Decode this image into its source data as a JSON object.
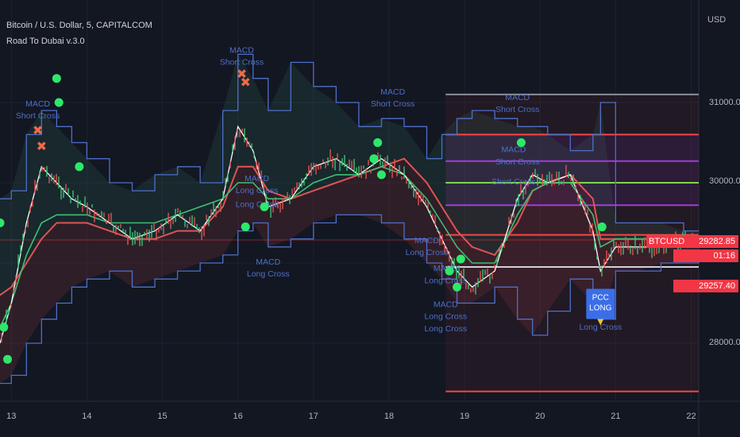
{
  "header": {
    "symbol_line": "Bitcoin / U.S. Dollar, 5, CAPITALCOM",
    "indicator": "Road To Dubai v.3.0"
  },
  "price_axis": {
    "currency": "USD",
    "ticks": [
      "31000.00",
      "30000.00",
      "28000.00"
    ]
  },
  "price_tags": {
    "symbol": "BTCUSD",
    "last": "29282.85",
    "countdown": "01:16",
    "low": "29257.40"
  },
  "colors": {
    "background": "#131722",
    "band": "#4f6fc7",
    "ema_fast": "#ffffff",
    "ema_mid": "#3fbf73",
    "ema_slow": "#e05353",
    "signal_dot": "#2ee86a",
    "short_marker": "#ef6a4a",
    "accent_red": "#f23645",
    "level_red": "#f44747",
    "level_purple": "#a13dd6",
    "level_green": "#7fd64a"
  },
  "chart_data": {
    "type": "line",
    "title": "Bitcoin / U.S. Dollar, 5, CAPITALCOM",
    "x_ticks": [
      "13",
      "14",
      "15",
      "16",
      "17",
      "18",
      "19",
      "20",
      "21",
      "22"
    ],
    "x_range_days": [
      12.85,
      22.1
    ],
    "ylim": [
      27300,
      31900
    ],
    "grid": true,
    "series": [
      {
        "name": "upper band",
        "color": "#4f6fc7",
        "x": [
          12.85,
          13.0,
          13.2,
          13.4,
          13.6,
          13.8,
          14.0,
          14.3,
          14.6,
          14.9,
          15.2,
          15.5,
          15.8,
          16.0,
          16.2,
          16.4,
          16.7,
          17.0,
          17.3,
          17.6,
          17.9,
          18.2,
          18.5,
          18.7,
          18.9,
          19.1,
          19.4,
          19.7,
          19.9,
          20.1,
          20.4,
          20.7,
          20.8,
          21.0,
          21.3,
          21.6,
          21.9,
          22.1
        ],
        "values": [
          29800,
          29900,
          30600,
          30900,
          30700,
          30500,
          30300,
          30000,
          29900,
          30100,
          30200,
          30000,
          30900,
          31600,
          31300,
          30900,
          31500,
          31200,
          31000,
          30700,
          30800,
          30700,
          30300,
          30600,
          30800,
          30900,
          30800,
          30700,
          30700,
          30600,
          30400,
          30600,
          31000,
          29500,
          29500,
          29500,
          29400,
          29400
        ]
      },
      {
        "name": "lower band",
        "color": "#4f6fc7",
        "x": [
          12.85,
          13.0,
          13.2,
          13.4,
          13.6,
          13.8,
          14.0,
          14.3,
          14.6,
          14.9,
          15.2,
          15.5,
          15.8,
          16.0,
          16.2,
          16.4,
          16.7,
          17.0,
          17.3,
          17.6,
          17.9,
          18.2,
          18.5,
          18.7,
          18.9,
          19.1,
          19.4,
          19.7,
          19.9,
          20.1,
          20.4,
          20.7,
          20.8,
          21.0,
          21.3,
          21.6,
          21.9,
          22.1
        ],
        "values": [
          27500,
          27600,
          28000,
          28300,
          28500,
          28700,
          28800,
          28900,
          28700,
          28800,
          28900,
          29000,
          29100,
          29400,
          29500,
          29200,
          29300,
          29500,
          29600,
          29600,
          29500,
          29300,
          29000,
          28800,
          28500,
          28500,
          28700,
          28300,
          28100,
          28400,
          28800,
          28500,
          28300,
          28900,
          28900,
          29000,
          29000,
          29100
        ]
      },
      {
        "name": "EMA fast",
        "color": "#ffffff",
        "x": [
          12.85,
          13.0,
          13.2,
          13.4,
          13.6,
          13.8,
          14.0,
          14.3,
          14.6,
          14.9,
          15.2,
          15.5,
          15.8,
          16.0,
          16.2,
          16.4,
          16.7,
          17.0,
          17.3,
          17.6,
          17.9,
          18.2,
          18.5,
          18.7,
          18.9,
          19.1,
          19.4,
          19.7,
          19.9,
          20.1,
          20.4,
          20.7,
          20.8,
          21.0,
          21.3,
          21.6,
          21.9,
          22.1
        ],
        "values": [
          28000,
          28500,
          29500,
          30200,
          30000,
          29800,
          29700,
          29500,
          29300,
          29400,
          29600,
          29400,
          29800,
          30700,
          30400,
          29700,
          29800,
          30200,
          30300,
          30100,
          30300,
          30100,
          29700,
          29300,
          28900,
          28700,
          28900,
          29800,
          30100,
          30000,
          30100,
          29400,
          28900,
          29200,
          29200,
          29200,
          29300,
          29300
        ]
      },
      {
        "name": "EMA mid",
        "color": "#3fbf73",
        "x": [
          12.85,
          13.0,
          13.2,
          13.4,
          13.6,
          13.8,
          14.0,
          14.3,
          14.6,
          14.9,
          15.2,
          15.5,
          15.8,
          16.0,
          16.2,
          16.4,
          16.7,
          17.0,
          17.3,
          17.6,
          17.9,
          18.2,
          18.5,
          18.7,
          18.9,
          19.1,
          19.4,
          19.7,
          19.9,
          20.1,
          20.4,
          20.7,
          20.8,
          21.0,
          21.3,
          21.6,
          21.9,
          22.1
        ],
        "values": [
          28200,
          28500,
          29100,
          29500,
          29600,
          29600,
          29600,
          29500,
          29500,
          29500,
          29600,
          29700,
          29800,
          30000,
          30000,
          29800,
          29800,
          30000,
          30100,
          30100,
          30200,
          30100,
          29800,
          29500,
          29200,
          29000,
          29000,
          29600,
          29900,
          30000,
          30000,
          29600,
          29200,
          29300,
          29300,
          29300,
          29300,
          29300
        ]
      },
      {
        "name": "EMA slow",
        "color": "#e05353",
        "x": [
          12.85,
          13.0,
          13.2,
          13.4,
          13.6,
          13.8,
          14.0,
          14.3,
          14.6,
          14.9,
          15.2,
          15.5,
          15.8,
          16.0,
          16.2,
          16.4,
          16.7,
          17.0,
          17.3,
          17.6,
          17.9,
          18.2,
          18.5,
          18.7,
          18.9,
          19.1,
          19.4,
          19.7,
          19.9,
          20.1,
          20.4,
          20.7,
          20.8,
          21.0,
          21.3,
          21.6,
          21.9,
          22.1
        ],
        "values": [
          28600,
          28700,
          29000,
          29300,
          29500,
          29500,
          29500,
          29400,
          29300,
          29300,
          29400,
          29400,
          29700,
          30200,
          30200,
          29900,
          29800,
          29900,
          30000,
          30100,
          30200,
          30300,
          30000,
          29700,
          29400,
          29200,
          29100,
          29500,
          29900,
          30000,
          30100,
          29800,
          29300,
          29300,
          29300,
          29300,
          29300,
          29300
        ]
      }
    ],
    "levels": [
      {
        "y": 31100,
        "color": "#8a8f9a",
        "x_start": 18.75
      },
      {
        "y": 30600,
        "color": "#f44747",
        "x_start": 18.75
      },
      {
        "y": 30270,
        "color": "#a13dd6",
        "x_start": 18.75
      },
      {
        "y": 30000,
        "color": "#7fd64a",
        "x_start": 18.75
      },
      {
        "y": 29720,
        "color": "#a13dd6",
        "x_start": 18.75
      },
      {
        "y": 29350,
        "color": "#f44747",
        "x_start": 18.75
      },
      {
        "y": 28950,
        "color": "#cfd2d8",
        "x_start": 18.75
      },
      {
        "y": 27400,
        "color": "#f44747",
        "x_start": 18.75
      }
    ],
    "annotations": [
      {
        "text": "MACD",
        "x": 13.35,
        "y": 30950,
        "color": "#4f6fc7"
      },
      {
        "text": "Short Cross",
        "x": 13.35,
        "y": 30800,
        "color": "#4f6fc7"
      },
      {
        "text": "MACD",
        "x": 16.05,
        "y": 31620,
        "color": "#4f6fc7"
      },
      {
        "text": "Short Cross",
        "x": 16.05,
        "y": 31470,
        "color": "#4f6fc7"
      },
      {
        "text": "MACD",
        "x": 16.25,
        "y": 30020,
        "color": "#4f6fc7"
      },
      {
        "text": "Long Cross",
        "x": 16.25,
        "y": 29870,
        "color": "#4f6fc7"
      },
      {
        "text": "Long Cross",
        "x": 16.25,
        "y": 29700,
        "color": "#4f6fc7"
      },
      {
        "text": "MACD",
        "x": 16.4,
        "y": 28980,
        "color": "#4f6fc7"
      },
      {
        "text": "Long Cross",
        "x": 16.4,
        "y": 28830,
        "color": "#4f6fc7"
      },
      {
        "text": "MACD",
        "x": 18.05,
        "y": 31100,
        "color": "#4f6fc7"
      },
      {
        "text": "Short Cross",
        "x": 18.05,
        "y": 30950,
        "color": "#4f6fc7"
      },
      {
        "text": "MACD",
        "x": 18.5,
        "y": 29250,
        "color": "#4f6fc7"
      },
      {
        "text": "Long Cross",
        "x": 18.5,
        "y": 29100,
        "color": "#4f6fc7"
      },
      {
        "text": "MACD",
        "x": 18.75,
        "y": 28900,
        "color": "#4f6fc7"
      },
      {
        "text": "Long Cross",
        "x": 18.75,
        "y": 28750,
        "color": "#4f6fc7"
      },
      {
        "text": "MACD",
        "x": 18.75,
        "y": 28450,
        "color": "#4f6fc7"
      },
      {
        "text": "Long Cross",
        "x": 18.75,
        "y": 28300,
        "color": "#4f6fc7"
      },
      {
        "text": "Long Cross",
        "x": 18.75,
        "y": 28150,
        "color": "#4f6fc7"
      },
      {
        "text": "MACD",
        "x": 19.7,
        "y": 31030,
        "color": "#4f6fc7"
      },
      {
        "text": "Short Cross",
        "x": 19.7,
        "y": 30880,
        "color": "#4f6fc7"
      },
      {
        "text": "MACD",
        "x": 19.65,
        "y": 30380,
        "color": "#4f6fc7"
      },
      {
        "text": "Short Cross",
        "x": 19.7,
        "y": 30230,
        "color": "#4f6fc7"
      },
      {
        "text": "Short Cross",
        "x": 19.65,
        "y": 29980,
        "color": "#4f6fc7"
      },
      {
        "text": "MACD",
        "x": 20.8,
        "y": 28320,
        "color": "#4f6fc7"
      },
      {
        "text": "Long Cross",
        "x": 20.8,
        "y": 28170,
        "color": "#4f6fc7"
      }
    ],
    "callout": {
      "lines": [
        "PCC",
        "LONG"
      ],
      "x": 20.8,
      "y": 28500,
      "color": "#3a6ee8"
    },
    "signal_dots": [
      {
        "x": 12.85,
        "y": 29500
      },
      {
        "x": 12.9,
        "y": 28200
      },
      {
        "x": 12.95,
        "y": 27800
      },
      {
        "x": 13.6,
        "y": 31300
      },
      {
        "x": 13.63,
        "y": 31000
      },
      {
        "x": 13.9,
        "y": 30200
      },
      {
        "x": 16.1,
        "y": 29450
      },
      {
        "x": 16.35,
        "y": 29700
      },
      {
        "x": 17.8,
        "y": 30300
      },
      {
        "x": 17.85,
        "y": 30500
      },
      {
        "x": 17.9,
        "y": 30100
      },
      {
        "x": 18.8,
        "y": 28900
      },
      {
        "x": 18.9,
        "y": 28700
      },
      {
        "x": 18.95,
        "y": 29050
      },
      {
        "x": 19.75,
        "y": 30500
      },
      {
        "x": 20.82,
        "y": 29450
      }
    ],
    "short_markers": [
      {
        "x": 13.35,
        "y": 30600
      },
      {
        "x": 13.4,
        "y": 30400
      },
      {
        "x": 16.05,
        "y": 31300
      },
      {
        "x": 16.1,
        "y": 31200
      }
    ]
  }
}
